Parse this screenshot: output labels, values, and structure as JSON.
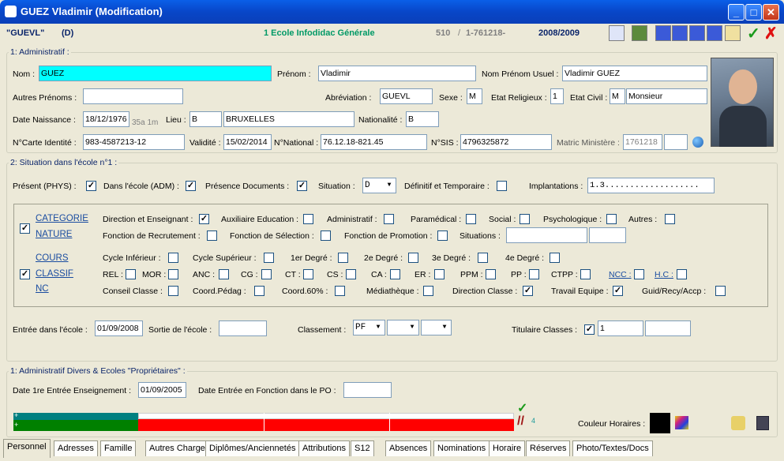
{
  "window": {
    "title": "GUEZ Vladimir (Modification)"
  },
  "header": {
    "code": "\"GUEVL\"",
    "flag": "(D)",
    "school": "1 Ecole Infodidac Générale",
    "num1": "510",
    "sep": "/",
    "num2": "1-761218-",
    "year": "2008/2009"
  },
  "section1": {
    "legend": "1: Administratif :",
    "nom_label": "Nom :",
    "nom": "GUEZ",
    "prenom_label": "Prénom :",
    "prenom": "Vladimir",
    "usuel_label": "Nom Prénom Usuel :",
    "usuel": "Vladimir GUEZ",
    "autres_label": "Autres Prénoms :",
    "autres": "",
    "abrev_label": "Abréviation :",
    "abrev": "GUEVL",
    "sexe_label": "Sexe :",
    "sexe": "M",
    "religieux_label": "Etat Religieux :",
    "religieux": "1",
    "civil_label": "Etat Civil :",
    "civil_code": "M",
    "civil": "Monsieur",
    "naissance_label": "Date Naissance :",
    "naissance": "18/12/1976",
    "age": "35a 1m",
    "lieu_label": "Lieu :",
    "lieu_code": "B",
    "lieu": "BRUXELLES",
    "nationalite_label": "Nationalité :",
    "nationalite": "B",
    "carte_label": "N°Carte Identité :",
    "carte": "983-4587213-12",
    "validite_label": "Validité :",
    "validite": "15/02/2014",
    "national_label": "N°National :",
    "national": "76.12.18-821.45",
    "sis_label": "N°SIS :",
    "sis": "4796325872",
    "matric_label": "Matric Ministère :",
    "matric": "1761218"
  },
  "section2": {
    "legend": "2: Situation dans l'école n°1 :",
    "present_label": "Présent (PHYS) :",
    "dans_label": "Dans l'école (ADM) :",
    "presence_label": "Présence Documents :",
    "situation_label": "Situation :",
    "situation": "D",
    "definitif_label": "Définitif et Temporaire :",
    "implantations_label": "Implantations :",
    "implantations": "1.3...................",
    "categorie": "CATEGORIE",
    "nature": "NATURE",
    "cours": "COURS",
    "classif": "CLASSIF",
    "nc": "NC",
    "r1": [
      "Direction et Enseignant :",
      "Auxiliaire Education :",
      "Administratif :",
      "Paramédical :",
      "Social :",
      "Psychologique :",
      "Autres :"
    ],
    "r2": [
      "Fonction de Recrutement :",
      "Fonction de Sélection :",
      "Fonction de Promotion :",
      "Situations :"
    ],
    "r3": [
      "Cycle Inférieur :",
      "Cycle Supérieur :",
      "1er Degré :",
      "2e Degré :",
      "3e Degré :",
      "4e Degré :"
    ],
    "r4": [
      "REL :",
      "MOR :",
      "ANC :",
      "CG :",
      "CT :",
      "CS :",
      "CA :",
      "ER :",
      "PPM :",
      "PP :",
      "CTPP :",
      "NCC :",
      "H.C :"
    ],
    "r5": [
      "Conseil Classe :",
      "Coord.Pédag :",
      "Coord.60% :",
      "Médiathèque :",
      "Direction Classe :",
      "Travail Equipe :",
      "Guid/Recy/Accp :"
    ],
    "entree_label": "Entrée dans l'école :",
    "entree": "01/09/2008",
    "sortie_label": "Sortie de l'école :",
    "classement_label": "Classement :",
    "classement": "PF",
    "titulaire_label": "Titulaire Classes :",
    "titulaire": "1"
  },
  "section3": {
    "legend": "1: Administratif Divers & Ecoles \"Propriétaires\" :",
    "date1_label": "Date 1re Entrée Enseignement :",
    "date1": "01/09/2005",
    "date2_label": "Date Entrée en Fonction dans le PO :",
    "count": "4",
    "couleur_label": "Couleur Horaires :"
  },
  "tabs": [
    "Personnel",
    "Adresses",
    "Famille",
    "Autres Charges",
    "Diplômes/Anciennetés",
    "Attributions",
    "S12",
    "Absences",
    "Nominations",
    "Horaire",
    "Réserves",
    "Photo/Textes/Docs"
  ],
  "colors": {
    "highlight": "#00ffff",
    "teal": "#008080",
    "green": "#008000",
    "red": "#ff0000"
  }
}
